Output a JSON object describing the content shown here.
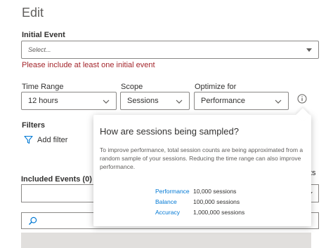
{
  "header": {
    "title": "Edit"
  },
  "initial_event": {
    "label": "Initial Event",
    "placeholder": "Select...",
    "error": "Please include at least one initial event"
  },
  "time_range": {
    "label": "Time Range",
    "value": "12 hours"
  },
  "scope": {
    "label": "Scope",
    "value": "Sessions"
  },
  "optimize": {
    "label": "Optimize for",
    "value": "Performance"
  },
  "filters": {
    "label": "Filters",
    "add_label": "Add filter"
  },
  "included_events": {
    "label": "Included Events (0)"
  },
  "partial_text": {
    "right_cut": "ts"
  },
  "popup": {
    "title": "How are sessions being sampled?",
    "body": "To improve performance, total session counts are being approximated from a random sample of your sessions. Reducing the time range can also improve performance.",
    "rates": [
      {
        "name": "Performance",
        "value": "10,000 sessions"
      },
      {
        "name": "Balance",
        "value": "100,000 sessions"
      },
      {
        "name": "Accuracy",
        "value": "1,000,000 sessions"
      }
    ]
  },
  "colors": {
    "accent": "#0078d4",
    "error": "#a4262c",
    "border": "#8a8886"
  }
}
